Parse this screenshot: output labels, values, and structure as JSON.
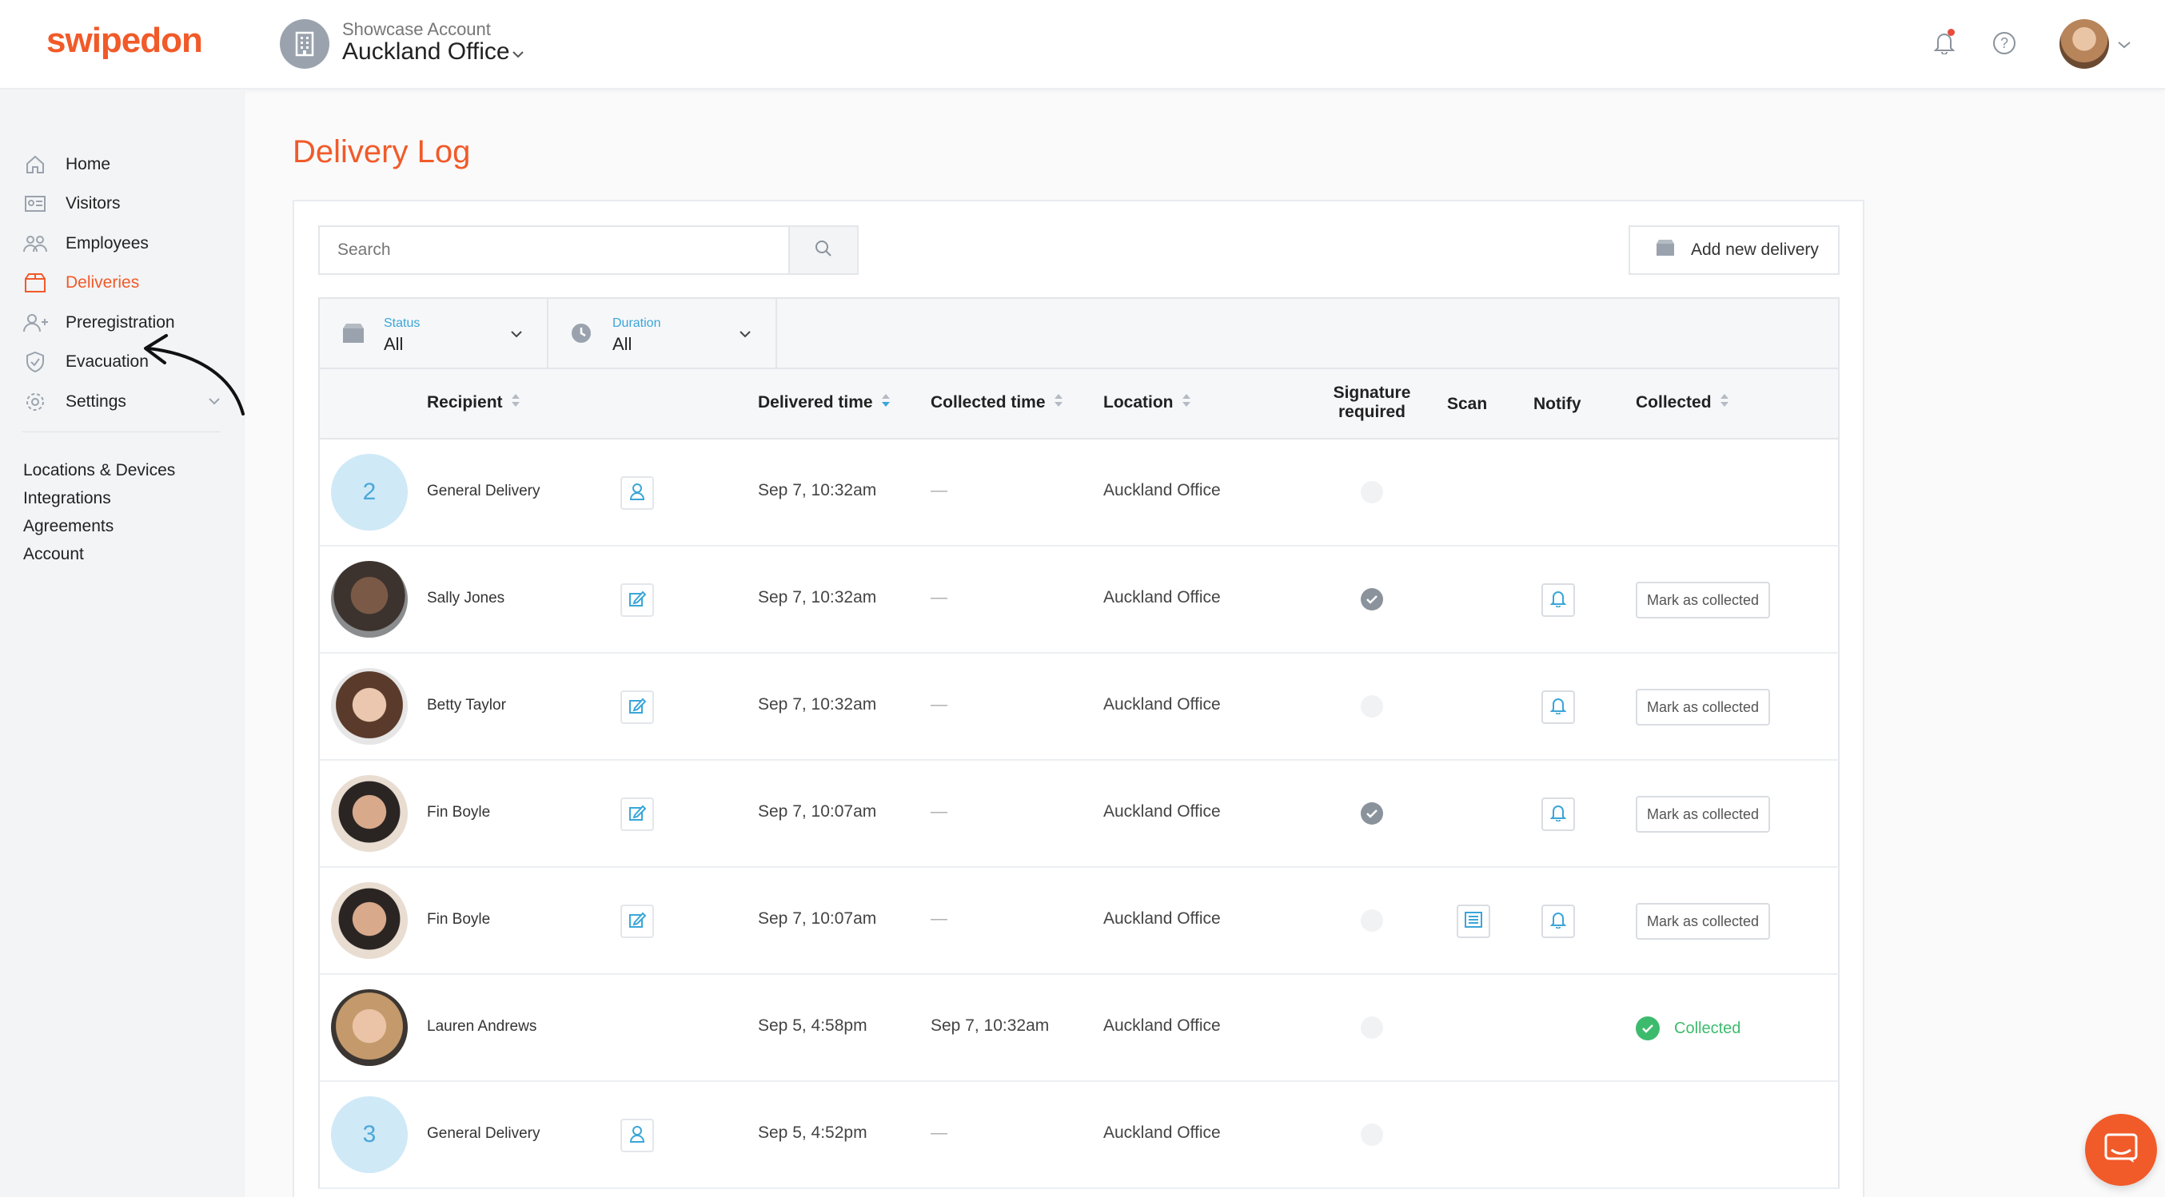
{
  "brand": {
    "logo_text": "swipedon",
    "accent": "#f15a29"
  },
  "account": {
    "label": "Showcase Account",
    "location": "Auckland Office"
  },
  "sidebar": {
    "items": [
      {
        "label": "Home",
        "icon": "home-icon"
      },
      {
        "label": "Visitors",
        "icon": "id-card-icon"
      },
      {
        "label": "Employees",
        "icon": "people-icon"
      },
      {
        "label": "Deliveries",
        "icon": "box-icon",
        "active": true
      },
      {
        "label": "Preregistration",
        "icon": "person-add-icon"
      },
      {
        "label": "Evacuation",
        "icon": "shield-icon"
      },
      {
        "label": "Settings",
        "icon": "gear-icon"
      }
    ],
    "links": [
      "Locations & Devices",
      "Integrations",
      "Agreements",
      "Account"
    ]
  },
  "page": {
    "title": "Delivery Log"
  },
  "search": {
    "placeholder": "Search"
  },
  "add_button": "Add new delivery",
  "filters": [
    {
      "label": "Status",
      "value": "All"
    },
    {
      "label": "Duration",
      "value": "All"
    }
  ],
  "columns": {
    "recipient": "Recipient",
    "delivered": "Delivered time",
    "collected_time": "Collected time",
    "location": "Location",
    "signature_1": "Signature",
    "signature_2": "required",
    "scan": "Scan",
    "notify": "Notify",
    "collected": "Collected"
  },
  "rows": [
    {
      "avatar": "2",
      "name": "General Delivery",
      "delivered": "Sep 7, 10:32am",
      "collected_time": "—",
      "location": "Auckland Office",
      "signature": false,
      "action": "person",
      "scan": false,
      "notify": false,
      "status": ""
    },
    {
      "avatar": "photo",
      "name": "Sally Jones",
      "delivered": "Sep 7, 10:32am",
      "collected_time": "—",
      "location": "Auckland Office",
      "signature": true,
      "action": "edit",
      "scan": false,
      "notify": true,
      "status": "Mark as collected"
    },
    {
      "avatar": "photo",
      "name": "Betty Taylor",
      "delivered": "Sep 7, 10:32am",
      "collected_time": "—",
      "location": "Auckland Office",
      "signature": false,
      "action": "edit",
      "scan": false,
      "notify": true,
      "status": "Mark as collected"
    },
    {
      "avatar": "photo",
      "name": "Fin Boyle",
      "delivered": "Sep 7, 10:07am",
      "collected_time": "—",
      "location": "Auckland Office",
      "signature": true,
      "action": "edit",
      "scan": false,
      "notify": true,
      "status": "Mark as collected"
    },
    {
      "avatar": "photo",
      "name": "Fin Boyle",
      "delivered": "Sep 7, 10:07am",
      "collected_time": "—",
      "location": "Auckland Office",
      "signature": false,
      "action": "edit",
      "scan": true,
      "notify": true,
      "status": "Mark as collected"
    },
    {
      "avatar": "photo",
      "name": "Lauren Andrews",
      "delivered": "Sep 5, 4:58pm",
      "collected_time": "Sep 7, 10:32am",
      "location": "Auckland Office",
      "signature": false,
      "action": "",
      "scan": false,
      "notify": false,
      "status": "Collected"
    },
    {
      "avatar": "3",
      "name": "General Delivery",
      "delivered": "Sep 5, 4:52pm",
      "collected_time": "—",
      "location": "Auckland Office",
      "signature": false,
      "action": "person",
      "scan": false,
      "notify": false,
      "status": ""
    }
  ]
}
